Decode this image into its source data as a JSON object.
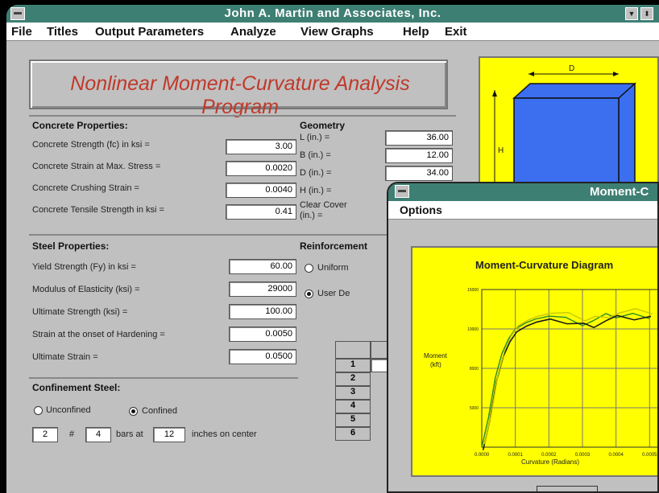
{
  "window": {
    "title": "John A. Martin and Associates, Inc.",
    "min_icon": "down-arrow-icon",
    "max_icon": "updown-arrow-icon"
  },
  "menu": [
    "File",
    "Titles",
    "Output Parameters",
    "Analyze",
    "View Graphs",
    "Help",
    "Exit"
  ],
  "banner": "Nonlinear Moment-Curvature Analysis Program",
  "concrete": {
    "title": "Concrete Properties:",
    "rows": [
      {
        "label": "Concrete Strength (fc) in ksi =",
        "value": "3.00"
      },
      {
        "label": "Concrete Strain at Max. Stress =",
        "value": "0.0020"
      },
      {
        "label": "Concrete Crushing Strain =",
        "value": "0.0040"
      },
      {
        "label": "Concrete Tensile Strength in ksi =",
        "value": "0.41"
      }
    ]
  },
  "geometry": {
    "title": "Geometry",
    "rows": [
      {
        "label": "L (in.) =",
        "value": "36.00"
      },
      {
        "label": "B (in.) =",
        "value": "12.00"
      },
      {
        "label": "D (in.) =",
        "value": "34.00"
      },
      {
        "label": "H (in.) =",
        "value": ""
      },
      {
        "label": "Clear Cover",
        "label2": "(in.) =",
        "value": ""
      }
    ]
  },
  "steel": {
    "title": "Steel Properties:",
    "rows": [
      {
        "label": "Yield Strength (Fy) in ksi =",
        "value": "60.00"
      },
      {
        "label": "Modulus of Elasticity (ksi) =",
        "value": "29000"
      },
      {
        "label": "Ultimate Strength (ksi) =",
        "value": "100.00"
      },
      {
        "label": "Strain at the onset of Hardening =",
        "value": "0.0050"
      },
      {
        "label": "Ultimate Strain =",
        "value": "0.0500"
      }
    ]
  },
  "reinforcement": {
    "title": "Reinforcement",
    "option1": "Uniform",
    "option2": "User De",
    "selected": "option2",
    "table_rows": [
      "1",
      "2",
      "3",
      "4",
      "5",
      "6"
    ]
  },
  "confinement": {
    "title": "Confinement Steel:",
    "option1": "Unconfined",
    "option2": "Confined",
    "selected": "option2",
    "bars": "2",
    "hash": "#",
    "size": "4",
    "bars_at": "bars at",
    "spacing": "12",
    "suffix": "inches on center"
  },
  "section_diagram": {
    "label_d": "D",
    "label_h": "H",
    "fill": "#3b6ff0",
    "background": "#ffff00"
  },
  "child_window": {
    "title": "Moment-C",
    "menu": "Options",
    "plot_title": "Moment-Curvature Diagram",
    "ylabel_line1": "Moment",
    "ylabel_line2": "(kft)",
    "xlabel": "Curvature (Radians)",
    "y_ticks": [
      "15000",
      "10000",
      "8000",
      "5000"
    ],
    "x_ticks": [
      "0.0000",
      "0.0001",
      "0.0002",
      "0.0003",
      "0.0004",
      "0.0005"
    ]
  },
  "chart_data": {
    "type": "line",
    "title": "Moment-Curvature Diagram",
    "xlabel": "Curvature (Radians)",
    "ylabel": "Moment (kft)",
    "x": [
      0.0,
      2e-05,
      4e-05,
      6e-05,
      8e-05,
      0.0001,
      0.00013,
      0.00016,
      0.0002,
      0.00025,
      0.0003,
      0.00033,
      0.00037,
      0.0004,
      0.00045,
      0.0005
    ],
    "values": [
      0,
      3000,
      7000,
      9500,
      11000,
      12000,
      12600,
      13000,
      13300,
      13000,
      12700,
      12800,
      13200,
      13300,
      13400,
      13400
    ],
    "colors": [
      "#2a8a2a",
      "#1a1a1a",
      "#c8c800"
    ]
  }
}
